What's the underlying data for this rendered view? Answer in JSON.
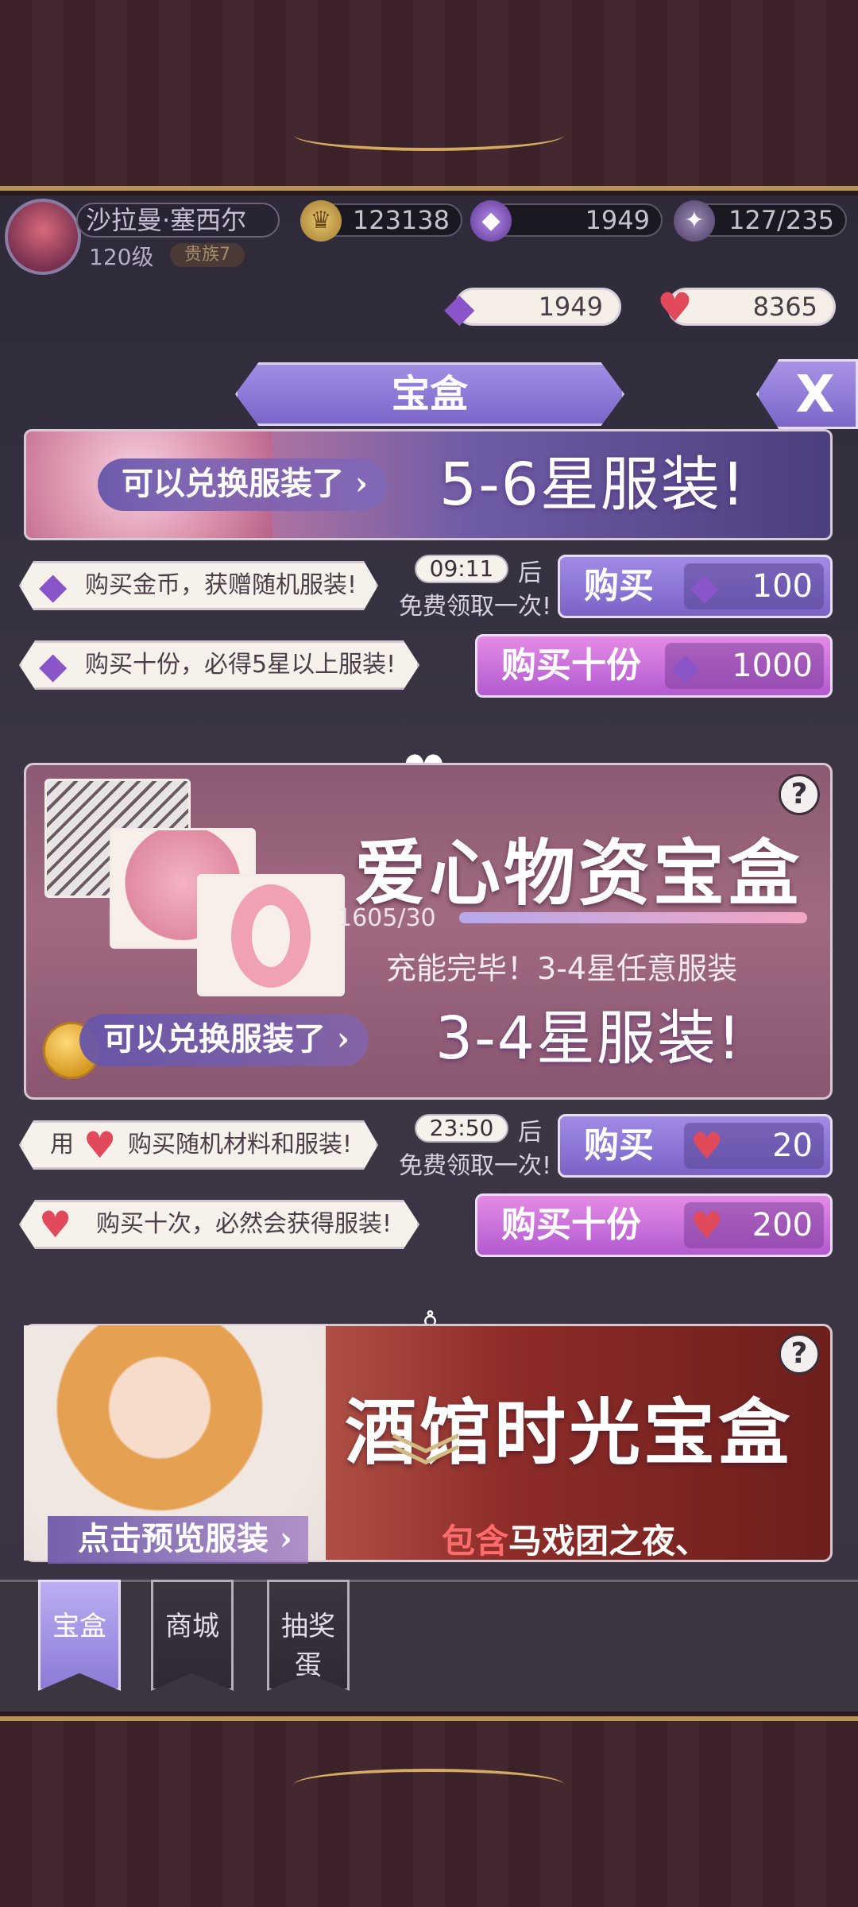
{
  "player": {
    "name": "沙拉曼·塞西尔",
    "level": "120级",
    "rank": "贵族7"
  },
  "resources": {
    "coins": "123138",
    "gems": "1949",
    "stamina": "127/235"
  },
  "wallet": {
    "gems": "1949",
    "hearts": "8365"
  },
  "title": "宝盒",
  "close_label": "X",
  "box1": {
    "exchange_tag": "可以兑换服装了",
    "exchange_value": "5-6星服装!",
    "buy_info": "购买金币，获赠随机服装!",
    "buy10_info": "购买十份，必得5星以上服装!",
    "timer": "09:11",
    "timer_after": "后",
    "free_text": "免费领取一次!",
    "buy_label": "购买",
    "buy_price": "100",
    "buy10_label": "购买十份",
    "buy10_price": "1000"
  },
  "box2": {
    "title": "爱心物资宝盒",
    "progress_text": "1605/30",
    "progress_ratio": 1.0,
    "charge_text": "充能完毕！3-4星任意服装",
    "exchange_tag": "可以兑换服装了",
    "exchange_value": "3-4星服装!",
    "use_prefix": "用",
    "buy_info": "购买随机材料和服装!",
    "buy10_info": "购买十次，必然会获得服装!",
    "timer": "23:50",
    "timer_after": "后",
    "free_text": "免费领取一次!",
    "buy_label": "购买",
    "buy_price": "20",
    "buy10_label": "购买十份",
    "buy10_price": "200"
  },
  "box3": {
    "title": "酒馆时光宝盒",
    "preview_tag": "点击预览服装",
    "contains_prefix": "包含",
    "contains_text": "马戏团之夜、"
  },
  "tabs": [
    {
      "label": "宝盒",
      "active": true
    },
    {
      "label": "商城",
      "active": false
    },
    {
      "label": "抽奖蛋",
      "active": false
    }
  ],
  "colors": {
    "accent_purple": "#8c7ad6",
    "accent_pink": "#c863d4",
    "heart_red": "#e04a5a",
    "gem_purple": "#8a55c8"
  },
  "icons": [
    "crown-coin-icon",
    "gem-icon",
    "stamina-icon",
    "heart-icon",
    "question-icon",
    "close-icon",
    "dress-icon",
    "chevron-down-icon"
  ]
}
